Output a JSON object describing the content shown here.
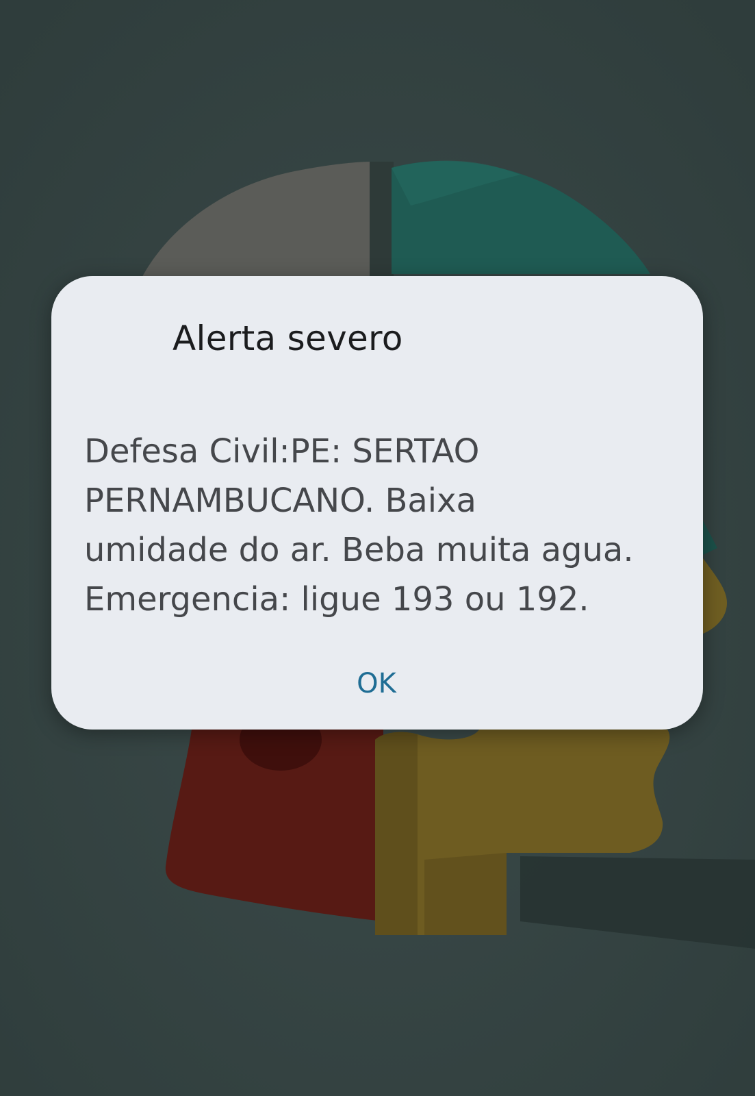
{
  "wallpaper": {
    "icon": "puzzle-head-icon",
    "colors": {
      "background": "#344342",
      "gray_piece": "#595a56",
      "teal_piece": "#1d5a52",
      "red_piece": "#5c1d17",
      "yellow_piece": "#6f5e22"
    }
  },
  "alert": {
    "title": "Alerta severo",
    "message": "Defesa Civil:PE: SERTAO\nPERNAMBUCANO. Baixa\numidade do ar. Beba muita agua.\nEmergencia: ligue 193 ou 192.",
    "ok_label": "OK",
    "colors": {
      "dialog_background": "#e9ecf1",
      "title": "#1b1c1e",
      "message": "#45474b",
      "button": "#1f6d94"
    }
  }
}
